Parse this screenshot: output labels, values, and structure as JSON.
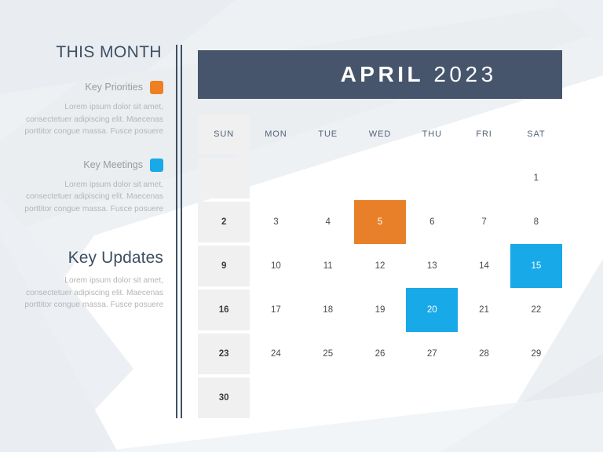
{
  "theme": {
    "dark_navy": "#46556c",
    "accent_orange": "#e8802a",
    "accent_blue": "#17a9e8",
    "cell_gray": "#f0f0f0",
    "body_text_gray": "#b5b5b5",
    "page_background": "#ffffff"
  },
  "sidebar": {
    "title": "THIS MONTH",
    "legend": [
      {
        "label": "Key Priorities",
        "swatch_color": "#ef7f23",
        "body": "Lorem ipsum dolor sit amet, consectetuer adipiscing elit. Maecenas porttitor congue massa. Fusce posuere"
      },
      {
        "label": "Key Meetings",
        "swatch_color": "#17a9e8",
        "body": "Lorem ipsum dolor sit amet, consectetuer adipiscing elit. Maecenas porttitor congue massa. Fusce posuere"
      }
    ],
    "key_updates": {
      "title": "Key Updates",
      "body": "Lorem ipsum dolor sit amet, consectetuer adipiscing elit. Maecenas porttitor congue massa. Fusce posuere"
    }
  },
  "calendar": {
    "month": "APRIL",
    "year": "2023",
    "weekdays": [
      "SUN",
      "MON",
      "TUE",
      "WED",
      "THU",
      "FRI",
      "SAT"
    ],
    "cells": [
      {
        "label": "",
        "col": 0,
        "highlight": "none"
      },
      {
        "label": "",
        "col": 1,
        "highlight": "none"
      },
      {
        "label": "",
        "col": 2,
        "highlight": "none"
      },
      {
        "label": "",
        "col": 3,
        "highlight": "none"
      },
      {
        "label": "",
        "col": 4,
        "highlight": "none"
      },
      {
        "label": "",
        "col": 5,
        "highlight": "none"
      },
      {
        "label": "1",
        "col": 6,
        "highlight": "none"
      },
      {
        "label": "2",
        "col": 0,
        "highlight": "none"
      },
      {
        "label": "3",
        "col": 1,
        "highlight": "none"
      },
      {
        "label": "4",
        "col": 2,
        "highlight": "none"
      },
      {
        "label": "5",
        "col": 3,
        "highlight": "orange"
      },
      {
        "label": "6",
        "col": 4,
        "highlight": "none"
      },
      {
        "label": "7",
        "col": 5,
        "highlight": "none"
      },
      {
        "label": "8",
        "col": 6,
        "highlight": "none"
      },
      {
        "label": "9",
        "col": 0,
        "highlight": "none"
      },
      {
        "label": "10",
        "col": 1,
        "highlight": "none"
      },
      {
        "label": "11",
        "col": 2,
        "highlight": "none"
      },
      {
        "label": "12",
        "col": 3,
        "highlight": "none"
      },
      {
        "label": "13",
        "col": 4,
        "highlight": "none"
      },
      {
        "label": "14",
        "col": 5,
        "highlight": "none"
      },
      {
        "label": "15",
        "col": 6,
        "highlight": "blue"
      },
      {
        "label": "16",
        "col": 0,
        "highlight": "none"
      },
      {
        "label": "17",
        "col": 1,
        "highlight": "none"
      },
      {
        "label": "18",
        "col": 2,
        "highlight": "none"
      },
      {
        "label": "19",
        "col": 3,
        "highlight": "none"
      },
      {
        "label": "20",
        "col": 4,
        "highlight": "blue"
      },
      {
        "label": "21",
        "col": 5,
        "highlight": "none"
      },
      {
        "label": "22",
        "col": 6,
        "highlight": "none"
      },
      {
        "label": "23",
        "col": 0,
        "highlight": "none"
      },
      {
        "label": "24",
        "col": 1,
        "highlight": "none"
      },
      {
        "label": "25",
        "col": 2,
        "highlight": "none"
      },
      {
        "label": "26",
        "col": 3,
        "highlight": "none"
      },
      {
        "label": "27",
        "col": 4,
        "highlight": "none"
      },
      {
        "label": "28",
        "col": 5,
        "highlight": "none"
      },
      {
        "label": "29",
        "col": 6,
        "highlight": "none"
      },
      {
        "label": "30",
        "col": 0,
        "highlight": "none"
      },
      {
        "label": "",
        "col": 1,
        "highlight": "none"
      },
      {
        "label": "",
        "col": 2,
        "highlight": "none"
      },
      {
        "label": "",
        "col": 3,
        "highlight": "none"
      },
      {
        "label": "",
        "col": 4,
        "highlight": "none"
      },
      {
        "label": "",
        "col": 5,
        "highlight": "none"
      },
      {
        "label": "",
        "col": 6,
        "highlight": "none"
      }
    ]
  }
}
